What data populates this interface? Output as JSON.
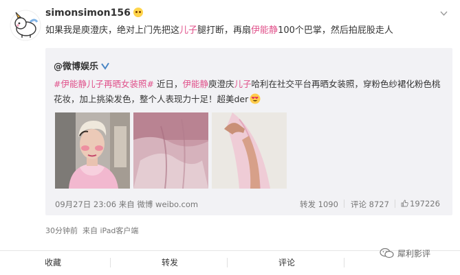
{
  "post": {
    "username": "simonsimon156",
    "text_before": "如果我是庾澄庆，绝对上门先把这",
    "text_highlight": "儿子",
    "text_middle": "腿打断，再扇",
    "text_name": "伊能静",
    "text_after": "100个巴掌，然后拍屁股走人",
    "timestamp": "30分钟前",
    "source": "来自 iPad客户端"
  },
  "repost": {
    "author": "@微博娱乐",
    "hashtag": "#伊能静儿子再晒女装照#",
    "text_1": " 近日，",
    "name_1": "伊能静",
    "text_2": "庾澄庆",
    "name_2": "儿子",
    "text_3": "哈利在社交平台再晒女装照，穿粉色纱裙化粉色桃花妆，加上挑染发色，整个人表现力十足！超美der",
    "date": "09月27日 23:06",
    "source": "来自 微博 weibo.com",
    "repost_label": "转发 1090",
    "comment_label": "评论 8727",
    "like_count": "197226"
  },
  "actions": {
    "favorite": "收藏",
    "forward": "转发",
    "comment": "评论"
  },
  "watermark": "犀利影评",
  "colors": {
    "accent_pink": "#e0508a",
    "link_blue": "#4a86c5",
    "repost_bg": "#f2f2f5"
  }
}
